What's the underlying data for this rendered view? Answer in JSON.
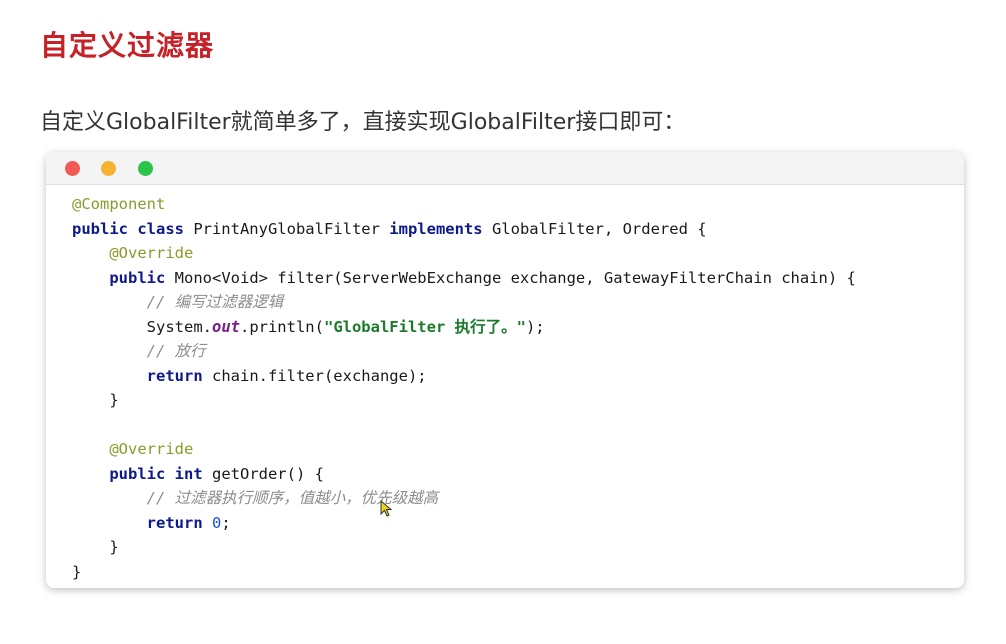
{
  "slide": {
    "title": "自定义过滤器",
    "description": "自定义GlobalFilter就简单多了，直接实现GlobalFilter接口即可："
  },
  "window_dots": [
    "red",
    "yellow",
    "green"
  ],
  "code": {
    "line1": "@Component",
    "line2": {
      "kw1": "public class",
      "t1": " PrintAnyGlobalFilter ",
      "kw2": "implements",
      "t2": " GlobalFilter, Ordered {"
    },
    "line3": "@Override",
    "line4": {
      "kw1": "public",
      "t1": " Mono<Void> filter(ServerWebExchange exchange, GatewayFilterChain chain) {"
    },
    "line5": "// 编写过滤器逻辑",
    "line6": {
      "t1": "System.",
      "field": "out",
      "t2": ".println(",
      "str": "\"GlobalFilter 执行了。\"",
      "t3": ");"
    },
    "line7": "// 放行",
    "line8": {
      "kw1": "return",
      "t1": " chain.filter(exchange);"
    },
    "line9": "}",
    "line10": "@Override",
    "line11": {
      "kw1": "public int",
      "t1": " getOrder() {"
    },
    "line12": "// 过滤器执行顺序，值越小，优先级越高",
    "line13": {
      "kw1": "return",
      "num": "0",
      "t1": ";"
    },
    "line14": "}",
    "line15": "}"
  }
}
